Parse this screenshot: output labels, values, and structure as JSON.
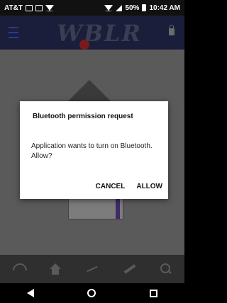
{
  "status_bar": {
    "carrier": "AT&T",
    "battery_percent": "50%",
    "time": "10:42 AM"
  },
  "app_header": {
    "logo_text": "WBLR"
  },
  "dialog": {
    "title": "Bluetooth permission request",
    "message": "Application wants to turn on Bluetooth. Allow?",
    "cancel_label": "CANCEL",
    "allow_label": "ALLOW"
  },
  "bottom_nav": {
    "items": [
      "wifi-icon",
      "home-icon",
      "chart-icon",
      "ruler-icon",
      "search-icon"
    ]
  },
  "system_nav": {
    "items": [
      "back-icon",
      "home-icon",
      "recents-icon"
    ]
  }
}
